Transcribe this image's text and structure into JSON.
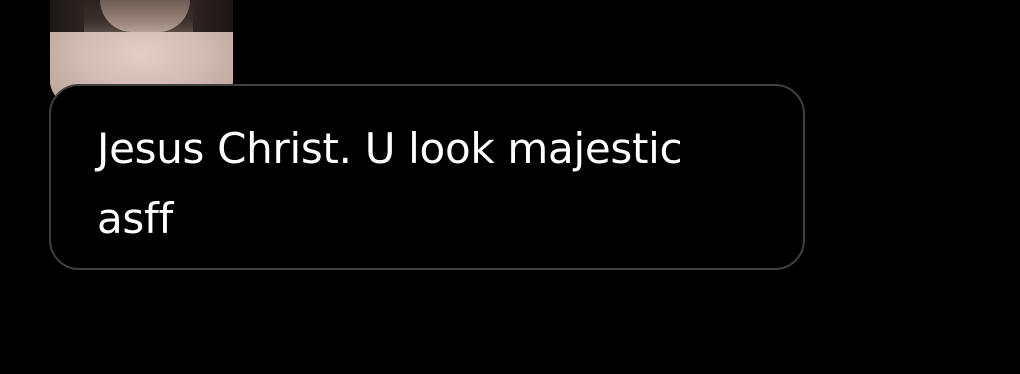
{
  "message": {
    "text": "Jesus Christ. U look majestic asff",
    "reply_thumbnail": "shirtless-photo-thumbnail"
  },
  "colors": {
    "background": "#000000",
    "bubble_border": "#3f3f3f",
    "text": "#ffffff"
  }
}
